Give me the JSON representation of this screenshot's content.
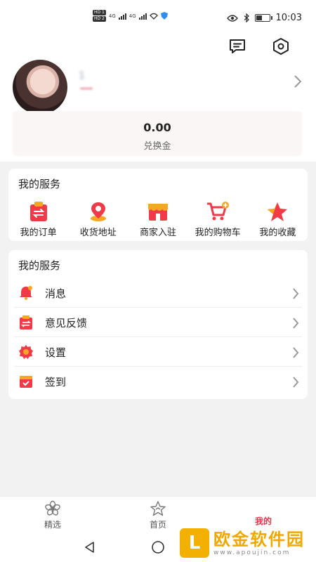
{
  "status_bar": {
    "sim1": "HD 1",
    "sim2": "HD 2",
    "net1": "4G",
    "net2": "4G",
    "time": "10:03"
  },
  "header": {
    "username": "1        ",
    "balance": {
      "value": "0.00",
      "label": "兑换金"
    }
  },
  "services": {
    "title": "我的服务",
    "items": [
      {
        "label": "我的订单",
        "icon": "order-icon"
      },
      {
        "label": "收货地址",
        "icon": "location-pin-icon"
      },
      {
        "label": "商家入驻",
        "icon": "store-icon"
      },
      {
        "label": "我的购物车",
        "icon": "cart-icon"
      },
      {
        "label": "我的收藏",
        "icon": "star-icon"
      }
    ]
  },
  "settings_list": {
    "title": "我的服务",
    "items": [
      {
        "label": "消息",
        "icon": "bell-icon"
      },
      {
        "label": "意见反馈",
        "icon": "feedback-icon"
      },
      {
        "label": "设置",
        "icon": "gear-icon"
      },
      {
        "label": "签到",
        "icon": "checkin-icon"
      }
    ]
  },
  "tabbar": {
    "tabs": [
      {
        "label": "精选",
        "icon": "flower-icon"
      },
      {
        "label": "首页",
        "icon": "home-star-icon"
      },
      {
        "label": "我的",
        "icon": "profile-icon"
      }
    ],
    "active_color": "#e8334a"
  },
  "watermark": {
    "logo": "L",
    "title": "欧金软件园",
    "url": "www.apoujin.com"
  },
  "colors": {
    "accent": "#e8334a",
    "icon_red": "#f03a48",
    "icon_orange": "#f5a623"
  }
}
